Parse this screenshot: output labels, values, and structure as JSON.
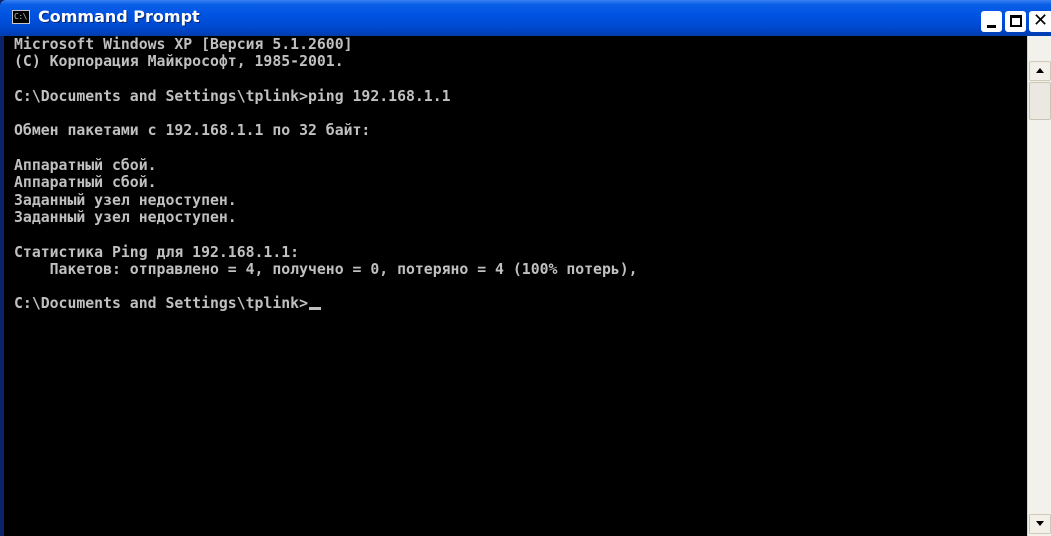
{
  "window": {
    "title": "Command Prompt",
    "icon": "console-icon",
    "icon_text": "C:\\"
  },
  "console": {
    "lines": [
      "Microsoft Windows XP [Версия 5.1.2600]",
      "(С) Корпорация Майкрософт, 1985-2001.",
      "",
      "C:\\Documents and Settings\\tplink>ping 192.168.1.1",
      "",
      "Обмен пакетами с 192.168.1.1 по 32 байт:",
      "",
      "Аппаратный сбой.",
      "Аппаратный сбой.",
      "Заданный узел недоступен.",
      "Заданный узел недоступен.",
      "",
      "Статистика Ping для 192.168.1.1:",
      "    Пакетов: отправлено = 4, получено = 0, потеряно = 4 (100% потерь),",
      "",
      "C:\\Documents and Settings\\tplink>"
    ]
  },
  "colors": {
    "titlebar": "#0054e3",
    "console_background": "#000000",
    "console_text": "#c0c0c0"
  }
}
